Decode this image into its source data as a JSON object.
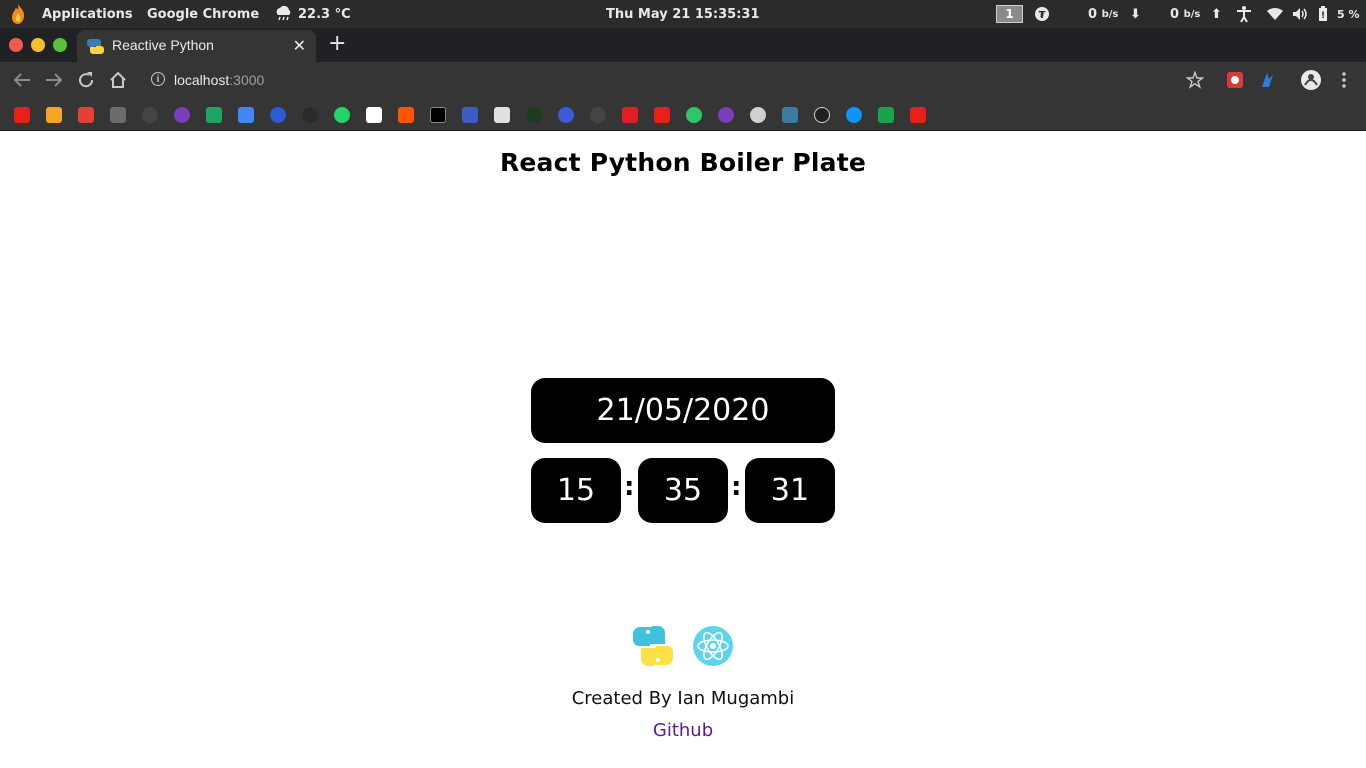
{
  "os": {
    "applications": "Applications",
    "active_app": "Google Chrome",
    "weather": "22.3 °C",
    "clock": "Thu May 21  15:35:31",
    "workspace": "1",
    "net_down_value": "0",
    "net_down_unit": "b/s",
    "net_up_value": "0",
    "net_up_unit": "b/s",
    "battery": "5 %"
  },
  "browser": {
    "tab_title": "Reactive Python",
    "url_host": "localhost",
    "url_port": ":3000"
  },
  "page": {
    "heading": "React Python Boiler Plate",
    "date": "21/05/2020",
    "hours": "15",
    "minutes": "35",
    "seconds": "31",
    "separator": ":",
    "credit": "Created By Ian Mugambi",
    "github_link": "Github"
  },
  "colors": {
    "accent_link": "#5c1a8f",
    "clock_box": "#000000"
  },
  "icons": {
    "python_logo": "python-logo-icon",
    "react_logo": "react-logo-icon"
  }
}
